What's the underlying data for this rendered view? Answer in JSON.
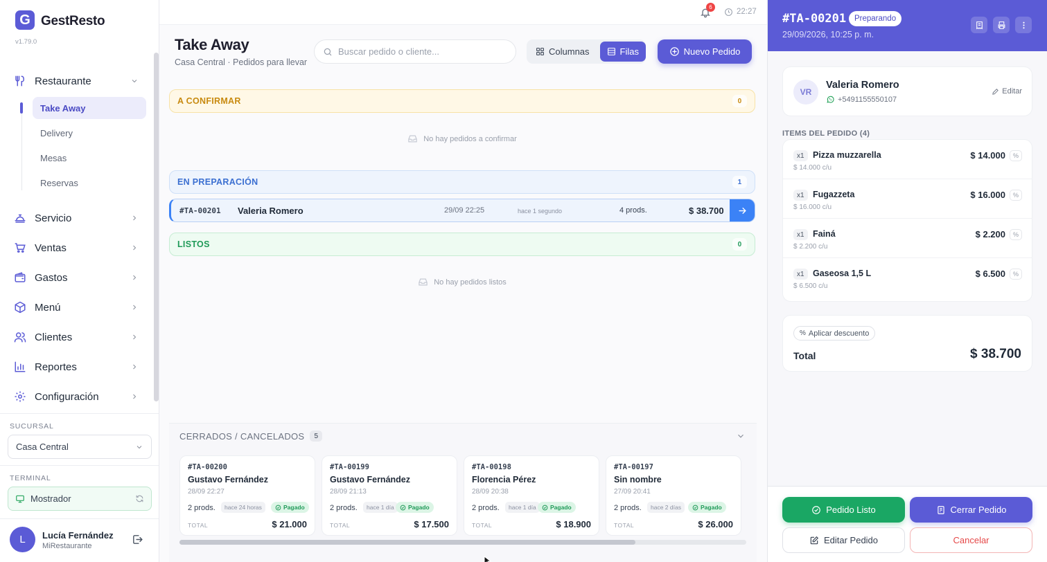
{
  "sidebar": {
    "brand": "GestResto",
    "logo_letter": "G",
    "version": "v1.79.0",
    "restaurant": {
      "label": "Restaurante",
      "icon": "utensils-icon"
    },
    "subitems": [
      {
        "label": "Take Away",
        "active": true
      },
      {
        "label": "Delivery"
      },
      {
        "label": "Mesas"
      },
      {
        "label": "Reservas"
      }
    ],
    "nav": [
      {
        "label": "Servicio",
        "icon": "bell-service-icon"
      },
      {
        "label": "Ventas",
        "icon": "cart-icon"
      },
      {
        "label": "Gastos",
        "icon": "wallet-icon"
      },
      {
        "label": "Menú",
        "icon": "box-icon"
      },
      {
        "label": "Clientes",
        "icon": "users-icon"
      },
      {
        "label": "Reportes",
        "icon": "bar-chart-icon"
      },
      {
        "label": "Configuración",
        "icon": "gear-icon"
      }
    ],
    "branch_label": "SUCURSAL",
    "branch_value": "Casa Central",
    "terminal_label": "TERMINAL",
    "terminal_value": "Mostrador",
    "user": {
      "initial": "L",
      "name": "Lucía Fernández",
      "role": "MiRestaurante"
    }
  },
  "topbar": {
    "notifications": "6",
    "time": "22:27"
  },
  "header": {
    "title": "Take Away",
    "subtitle": "Casa Central · Pedidos para llevar",
    "search_placeholder": "Buscar pedido o cliente...",
    "view_columns": "Columnas",
    "view_rows": "Filas",
    "new_order": "Nuevo Pedido"
  },
  "groups": {
    "confirm": {
      "label": "A CONFIRMAR",
      "count": "0",
      "empty": "No hay pedidos a confirmar"
    },
    "preparing": {
      "label": "EN PREPARACIÓN",
      "count": "1"
    },
    "ready": {
      "label": "LISTOS",
      "count": "0",
      "empty": "No hay pedidos listos"
    }
  },
  "active_order": {
    "id": "#TA-00201",
    "customer": "Valeria Romero",
    "date": "29/09 22:25",
    "ago": "hace 1 segundo",
    "prods": "4 prods.",
    "total": "$ 38.700"
  },
  "closed": {
    "label": "CERRADOS / CANCELADOS",
    "count": "5",
    "total_label": "TOTAL",
    "cards": [
      {
        "id": "#TA-00200",
        "name": "Gustavo Fernández",
        "date": "28/09 22:27",
        "prods": "2 prods.",
        "ago": "hace 24 horas",
        "status": "Pagado",
        "total": "$ 21.000"
      },
      {
        "id": "#TA-00199",
        "name": "Gustavo Fernández",
        "date": "28/09 21:13",
        "prods": "2 prods.",
        "ago": "hace 1 día",
        "status": "Pagado",
        "total": "$ 17.500"
      },
      {
        "id": "#TA-00198",
        "name": "Florencia Pérez",
        "date": "28/09 20:38",
        "prods": "2 prods.",
        "ago": "hace 1 día",
        "status": "Pagado",
        "total": "$ 18.900"
      },
      {
        "id": "#TA-00197",
        "name": "Sin nombre",
        "date": "27/09 20:41",
        "prods": "2 prods.",
        "ago": "hace 2 días",
        "status": "Pagado",
        "total": "$ 26.000"
      }
    ]
  },
  "panel": {
    "id": "#TA-00201",
    "status": "Preparando",
    "datetime": "29/09/2026, 10:25 p. m.",
    "customer": {
      "initials": "VR",
      "name": "Valeria Romero",
      "phone": "+5491155550107",
      "edit": "Editar"
    },
    "items_label": "ITEMS DEL PEDIDO (4)",
    "items": [
      {
        "qty": "x1",
        "name": "Pizza muzzarella",
        "unit": "$ 14.000 c/u",
        "price": "$ 14.000"
      },
      {
        "qty": "x1",
        "name": "Fugazzeta",
        "unit": "$ 16.000 c/u",
        "price": "$ 16.000"
      },
      {
        "qty": "x1",
        "name": "Fainá",
        "unit": "$ 2.200 c/u",
        "price": "$ 2.200"
      },
      {
        "qty": "x1",
        "name": "Gaseosa 1,5 L",
        "unit": "$ 6.500 c/u",
        "price": "$ 6.500"
      }
    ],
    "discount": "Aplicar descuento",
    "total_label": "Total",
    "total": "$ 38.700",
    "buttons": {
      "ready": "Pedido Listo",
      "close": "Cerrar Pedido",
      "edit": "Editar Pedido",
      "cancel": "Cancelar"
    }
  },
  "colors": {
    "accent": "#5b5bd6",
    "success": "#1aa764",
    "danger": "#e54848",
    "info": "#3b82f6",
    "warning": "#c88a10"
  }
}
